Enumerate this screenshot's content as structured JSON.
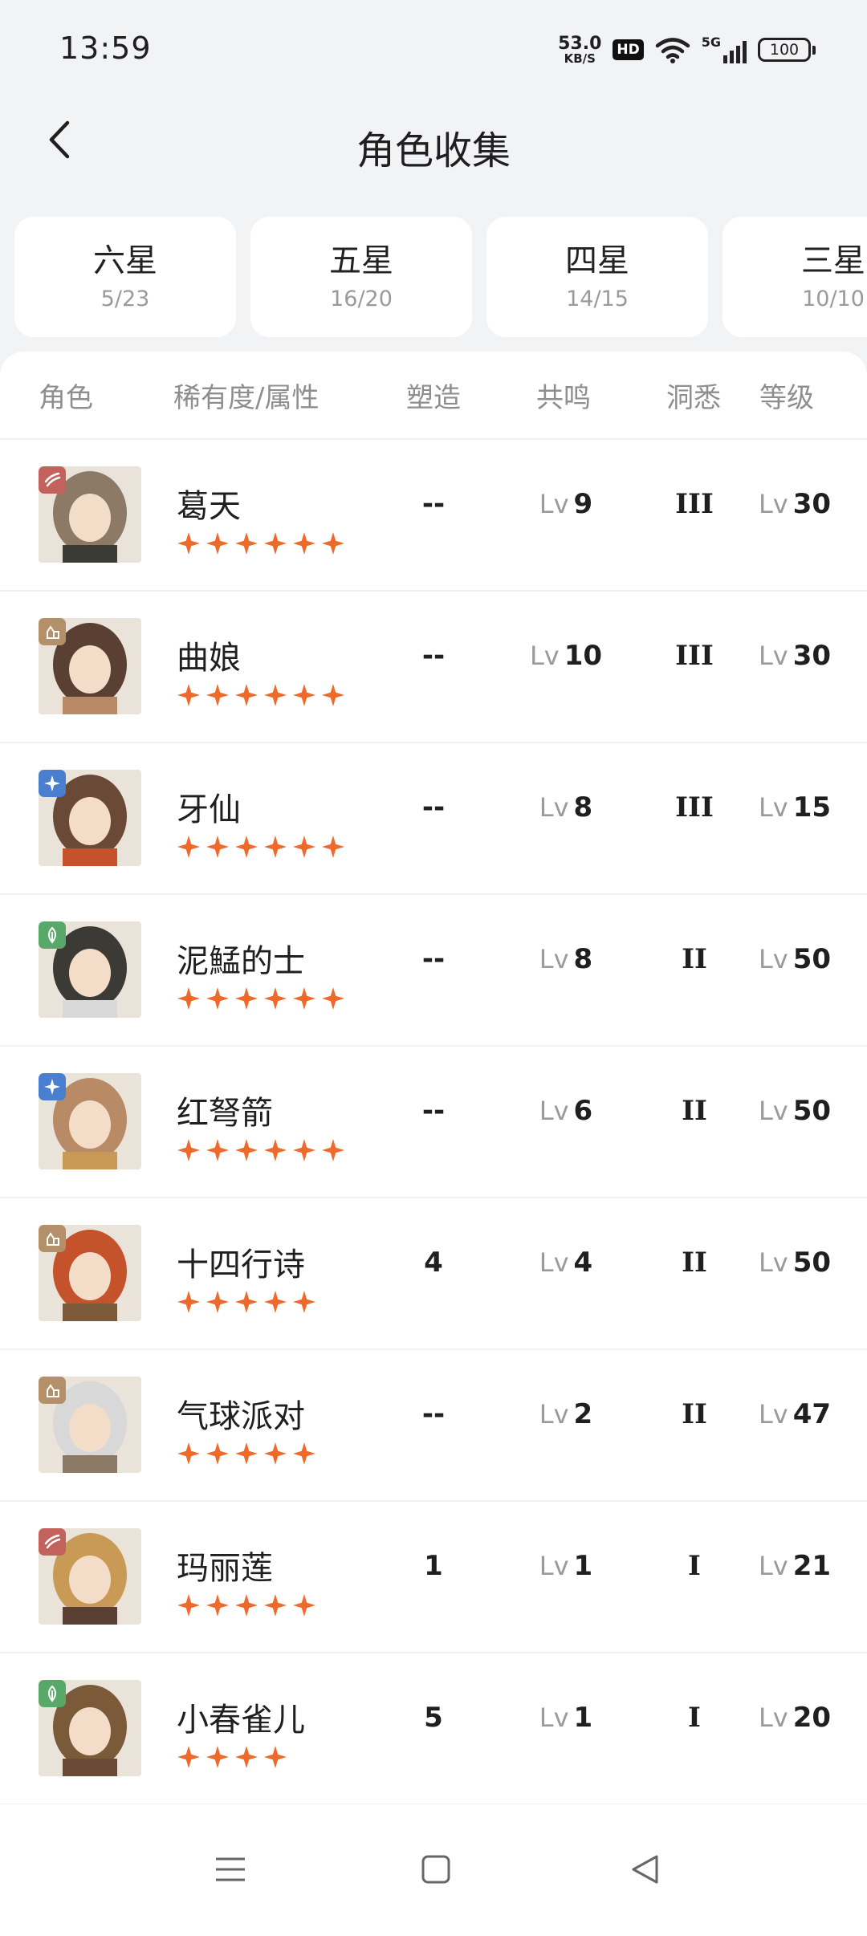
{
  "status_bar": {
    "time": "13:59",
    "net_speed_value": "53.0",
    "net_speed_unit": "KB/S",
    "hd_label": "HD",
    "network_label": "5G",
    "battery": "100"
  },
  "header": {
    "title": "角色收集",
    "back_icon": "chevron-left-icon"
  },
  "tabs": [
    {
      "name": "六星",
      "count": "5/23"
    },
    {
      "name": "五星",
      "count": "16/20"
    },
    {
      "name": "四星",
      "count": "14/15"
    },
    {
      "name": "三星",
      "count": "10/10"
    }
  ],
  "columns": {
    "role": "角色",
    "rarity_attr": "稀有度/属性",
    "shaping": "塑造",
    "resonance": "共鸣",
    "insight": "洞悉",
    "level": "等级"
  },
  "lv_prefix": "Lv",
  "attribute_colors": {
    "beast": "#c3625c",
    "spirit": "#b3906a",
    "star": "#4a7fcf",
    "plant": "#58a86a"
  },
  "star_color": "#ee6a2a",
  "characters": [
    {
      "name": "葛天",
      "stars": 6,
      "attribute": "beast",
      "shaping": "--",
      "resonance": "9",
      "insight": "III",
      "level": "30"
    },
    {
      "name": "曲娘",
      "stars": 6,
      "attribute": "spirit",
      "shaping": "--",
      "resonance": "10",
      "insight": "III",
      "level": "30"
    },
    {
      "name": "牙仙",
      "stars": 6,
      "attribute": "star",
      "shaping": "--",
      "resonance": "8",
      "insight": "III",
      "level": "15"
    },
    {
      "name": "泥鯭的士",
      "stars": 6,
      "attribute": "plant",
      "shaping": "--",
      "resonance": "8",
      "insight": "II",
      "level": "50"
    },
    {
      "name": "红弩箭",
      "stars": 6,
      "attribute": "star",
      "shaping": "--",
      "resonance": "6",
      "insight": "II",
      "level": "50"
    },
    {
      "name": "十四行诗",
      "stars": 5,
      "attribute": "spirit",
      "shaping": "4",
      "resonance": "4",
      "insight": "II",
      "level": "50"
    },
    {
      "name": "气球派对",
      "stars": 5,
      "attribute": "spirit",
      "shaping": "--",
      "resonance": "2",
      "insight": "II",
      "level": "47"
    },
    {
      "name": "玛丽莲",
      "stars": 5,
      "attribute": "beast",
      "shaping": "1",
      "resonance": "1",
      "insight": "I",
      "level": "21"
    },
    {
      "name": "小春雀儿",
      "stars": 4,
      "attribute": "plant",
      "shaping": "5",
      "resonance": "1",
      "insight": "I",
      "level": "20"
    }
  ],
  "nav_bar": {
    "menu_icon": "menu-icon",
    "home_icon": "home-square-icon",
    "back_icon": "back-triangle-icon"
  }
}
